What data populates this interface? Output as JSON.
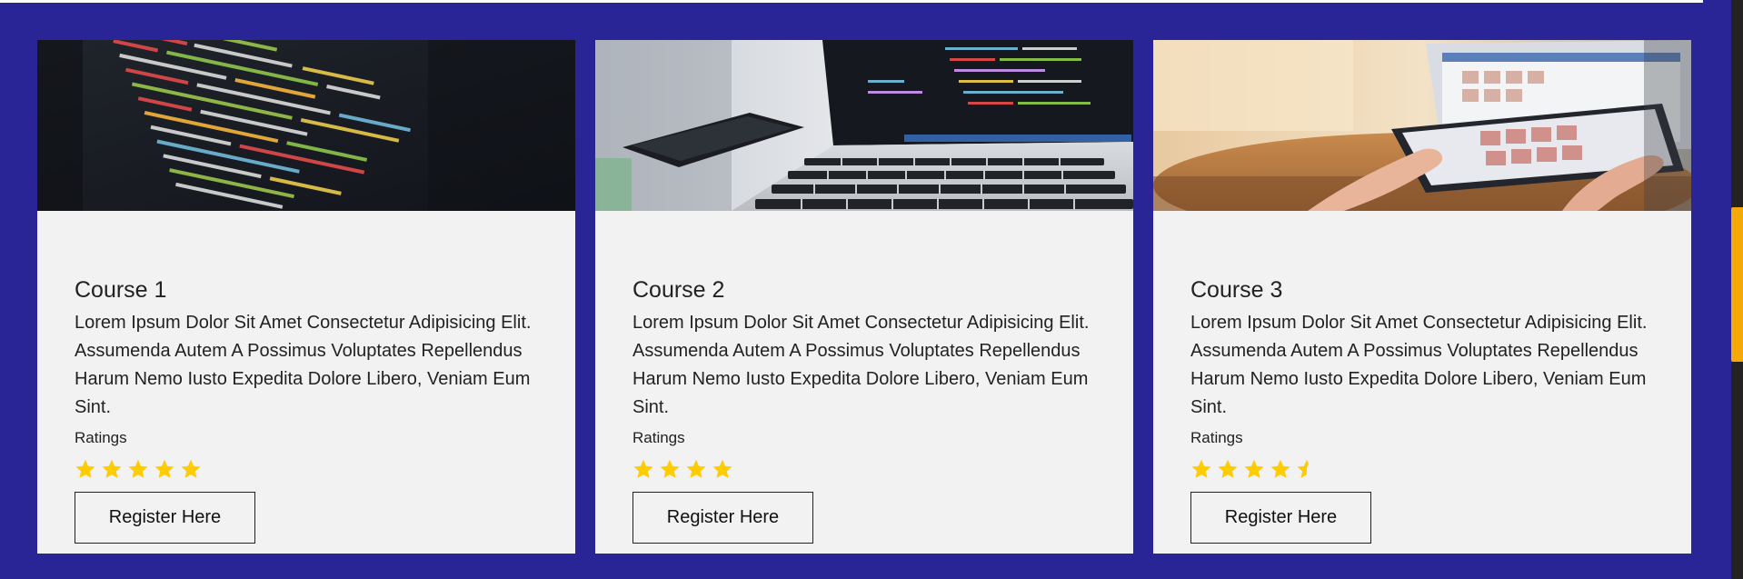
{
  "colors": {
    "page_background": "#2a2596",
    "card_background": "#f2f2f2",
    "star": "#ffcc00",
    "scrollbar_thumb": "#f5a906"
  },
  "courses": [
    {
      "image_icon": "code-on-laptop-photo",
      "title": "Course 1",
      "description": "Lorem Ipsum Dolor Sit Amet Consectetur Adipisicing Elit. Assumenda Autem A Possimus Voluptates Repellendus Harum Nemo Iusto Expedita Dolore Libero, Veniam Eum Sint.",
      "ratings_label": "Ratings",
      "rating": 5,
      "button_label": "Register Here"
    },
    {
      "image_icon": "laptop-and-phone-photo",
      "title": "Course 2",
      "description": "Lorem Ipsum Dolor Sit Amet Consectetur Adipisicing Elit. Assumenda Autem A Possimus Voluptates Repellendus Harum Nemo Iusto Expedita Dolore Libero, Veniam Eum Sint.",
      "ratings_label": "Ratings",
      "rating": 4,
      "button_label": "Register Here"
    },
    {
      "image_icon": "hands-on-tablet-photo",
      "title": "Course 3",
      "description": "Lorem Ipsum Dolor Sit Amet Consectetur Adipisicing Elit. Assumenda Autem A Possimus Voluptates Repellendus Harum Nemo Iusto Expedita Dolore Libero, Veniam Eum Sint.",
      "ratings_label": "Ratings",
      "rating": 4.5,
      "button_label": "Register Here"
    }
  ]
}
